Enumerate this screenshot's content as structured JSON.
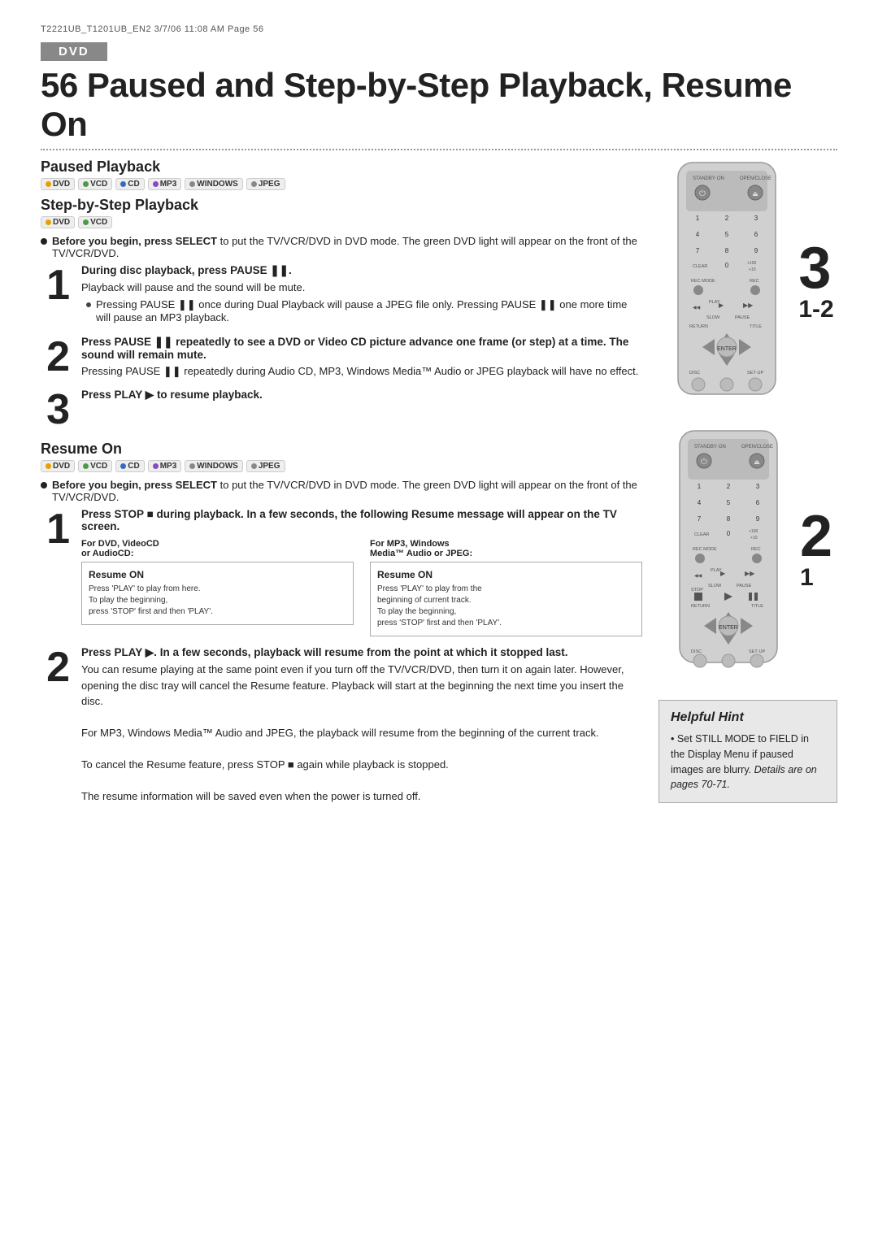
{
  "header": {
    "doc_ref": "T2221UB_T1201UB_EN2  3/7/06  11:08 AM  Page 56"
  },
  "dvd_badge": "DVD",
  "main_title": "56  Paused and Step-by-Step Playback, Resume On",
  "sections": {
    "paused_playback": {
      "heading": "Paused Playback",
      "compat": [
        "DVD",
        "VCD",
        "CD",
        "MP3",
        "WINDOWS AUDIO",
        "JPEG"
      ]
    },
    "step_by_step": {
      "heading": "Step-by-Step Playback",
      "compat": [
        "DVD",
        "VCD"
      ]
    },
    "before_begin_note": "Before you begin, press SELECT to put the TV/VCR/DVD in DVD mode. The green DVD light will appear on the front of the TV/VCR/DVD.",
    "step1": {
      "number": "1",
      "title": "During disc playback, press PAUSE ❚❚.",
      "body": "Playback will pause and the sound will be mute.",
      "sub1": "Pressing PAUSE ❚❚ once during Dual Playback will pause a JPEG file only. Pressing PAUSE ❚❚ one more time will pause an MP3 playback."
    },
    "step2": {
      "number": "2",
      "title": "Press PAUSE ❚❚ repeatedly to see a DVD or Video CD picture advance one frame (or step) at a time.",
      "body": "The sound will remain mute.\nPressing PAUSE ❚❚ repeatedly during Audio CD, MP3, Windows Media™ Audio or JPEG playback will have no effect."
    },
    "step3": {
      "number": "3",
      "title": "Press PLAY ▶ to resume playback."
    },
    "resume_on": {
      "heading": "Resume On",
      "compat": [
        "DVD",
        "VCD",
        "CD",
        "MP3",
        "WINDOWS AUDIO",
        "JPEG"
      ],
      "before_begin_note": "Before you begin, press SELECT to put the TV/VCR/DVD in DVD mode. The green DVD light will appear on the front of the TV/VCR/DVD.",
      "step1": {
        "number": "1",
        "title": "Press STOP ■ during playback.",
        "body": "In a few seconds, the following Resume message will appear on the TV screen.",
        "box_dvd_label": "For DVD, VideoCD\nor AudioCD:",
        "box_dvd_title": "Resume ON",
        "box_dvd_text": "Press 'PLAY' to play from here.\nTo play the beginning,\npress 'STOP' first and then 'PLAY'.",
        "box_mp3_label": "For MP3, Windows\nMedia™ Audio or JPEG:",
        "box_mp3_title": "Resume ON",
        "box_mp3_text": "Press 'PLAY' to play from the\nbeginning of current track.\nTo play the beginning,\npress 'STOP' first and then 'PLAY'."
      },
      "step2": {
        "number": "2",
        "title": "Press PLAY ▶.",
        "body": "In a few seconds, playback will resume from the point at which it stopped last.\nYou can resume playing at the same point even if you turn off the TV/VCR/DVD, then turn it on again later. However, opening the disc tray will cancel the Resume feature. Playback will start at the beginning the next time you insert the disc.\nFor MP3, Windows Media™ Audio and JPEG, the playback will resume from the beginning of the current track.\nTo cancel the Resume feature, press STOP ■ again while playback is stopped.\nThe resume information will be saved even when the power is turned off."
      }
    }
  },
  "helpful_hint": {
    "title": "Helpful Hint",
    "body": "• Set STILL MODE to FIELD in the Display Menu if paused images are blurry.",
    "italic_part": "Details are on pages 70-71."
  },
  "step_nums_top": {
    "big": "3",
    "small": "1-2"
  },
  "step_nums_bottom": {
    "big": "2",
    "small": "1"
  }
}
